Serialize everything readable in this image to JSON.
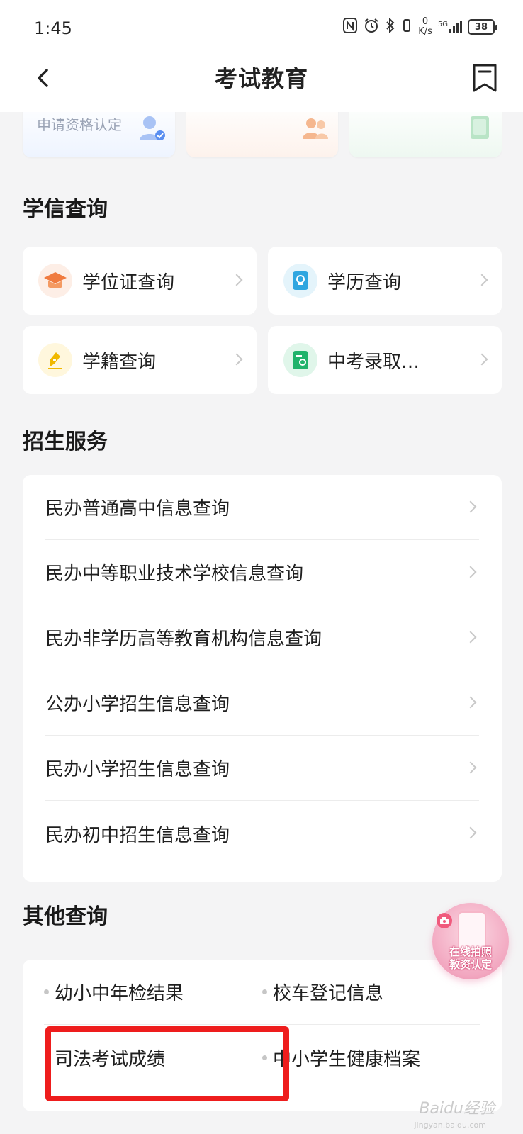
{
  "status_bar": {
    "time": "1:45",
    "net_speed_value": "0",
    "net_speed_unit": "K/s",
    "network": "5G",
    "battery": "38"
  },
  "header": {
    "title": "考试教育"
  },
  "promo_cards": [
    {
      "label": "申请资格认定"
    },
    {
      "label": ""
    },
    {
      "label": ""
    }
  ],
  "xuexin": {
    "title": "学信查询",
    "items": [
      {
        "label": "学位证查询",
        "icon": "graduation-cap-icon",
        "icon_color": "#f07b3f",
        "icon_bg": "#fdeee6"
      },
      {
        "label": "学历查询",
        "icon": "certificate-icon",
        "icon_color": "#2fa6e0",
        "icon_bg": "#e4f4fb"
      },
      {
        "label": "学籍查询",
        "icon": "pen-icon",
        "icon_color": "#f0b800",
        "icon_bg": "#fff7dd"
      },
      {
        "label": "中考录取…",
        "icon": "document-person-icon",
        "icon_color": "#20b36b",
        "icon_bg": "#e0f6ea"
      }
    ]
  },
  "zhaosheng": {
    "title": "招生服务",
    "items": [
      {
        "label": "民办普通高中信息查询"
      },
      {
        "label": "民办中等职业技术学校信息查询"
      },
      {
        "label": "民办非学历高等教育机构信息查询"
      },
      {
        "label": "公办小学招生信息查询"
      },
      {
        "label": "民办小学招生信息查询"
      },
      {
        "label": "民办初中招生信息查询"
      }
    ]
  },
  "other": {
    "title": "其他查询",
    "items": [
      {
        "label": "幼小中年检结果"
      },
      {
        "label": "校车登记信息"
      },
      {
        "label": "司法考试成绩"
      },
      {
        "label": "中小学生健康档案"
      }
    ]
  },
  "floating_badge": {
    "line1": "在线拍照",
    "line2": "教资认定"
  },
  "watermark": {
    "text": "Baidu经验",
    "sub": "jingyan.baidu.com"
  }
}
